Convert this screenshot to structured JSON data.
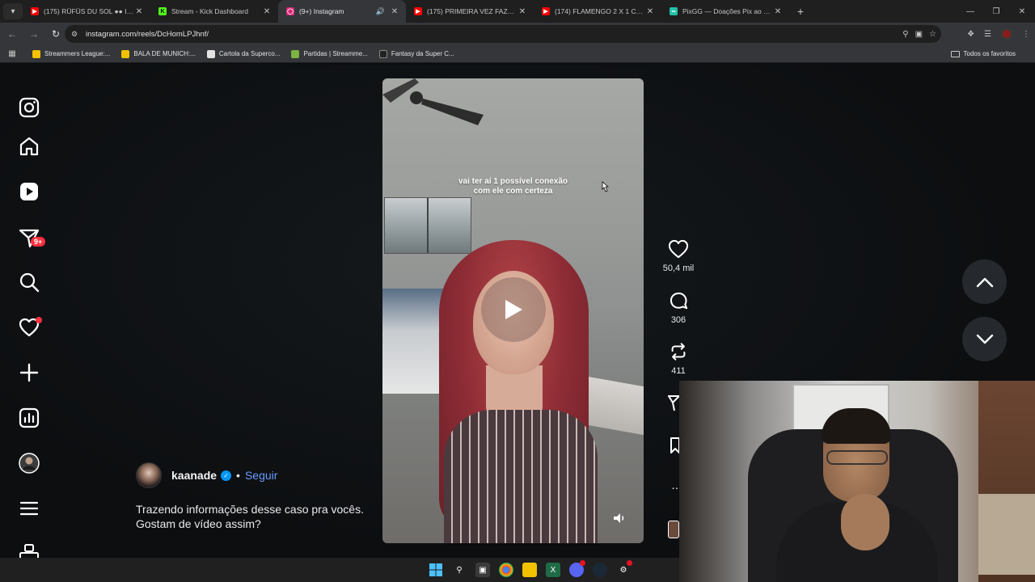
{
  "browser": {
    "tabs": [
      {
        "title": "(175) RÜFÜS DU SOL ●● Innerb",
        "favicon": "youtube-icon",
        "color": "#ff0000"
      },
      {
        "title": "Stream - Kick Dashboard",
        "favicon": "kick-icon",
        "color": "#53fc18"
      },
      {
        "title": "(9+) Instagram",
        "favicon": "instagram-icon",
        "color": "#d62976",
        "active": true
      },
      {
        "title": "(175) PRIMEIRA VEZ FAZENDO",
        "favicon": "youtube-icon",
        "color": "#ff0000"
      },
      {
        "title": "(174) FLAMENGO 2 X 1 CRUZEI",
        "favicon": "youtube-icon",
        "color": "#ff0000"
      },
      {
        "title": "PixGG — Doações Pix ao vivo p",
        "favicon": "pixgg-icon",
        "color": "#22c1a8"
      }
    ],
    "url": "instagram.com/reels/DcHomLPJhnf/",
    "bookmarks": [
      "Streammers League:...",
      "BALA DE MUNICH:...",
      "Cartola da Superco...",
      "Partidas | Streamme...",
      "Fantasy da Super C..."
    ],
    "all_bookmarks": "Todos os favoritos"
  },
  "instagram": {
    "notification_badge": "9+",
    "video_caption": "vai ter aí 1 possível conexão\ncom ele com certeza",
    "likes": "50,4 mil",
    "comments": "306",
    "reposts": "411",
    "author": {
      "username": "kaanade",
      "separator": "•",
      "follow": "Seguir"
    },
    "description": "Trazendo informações desse caso pra vocês.\nGostam de vídeo assim?"
  },
  "colors": {
    "accent_blue": "#0095f6",
    "notification_red": "#ff3040"
  }
}
